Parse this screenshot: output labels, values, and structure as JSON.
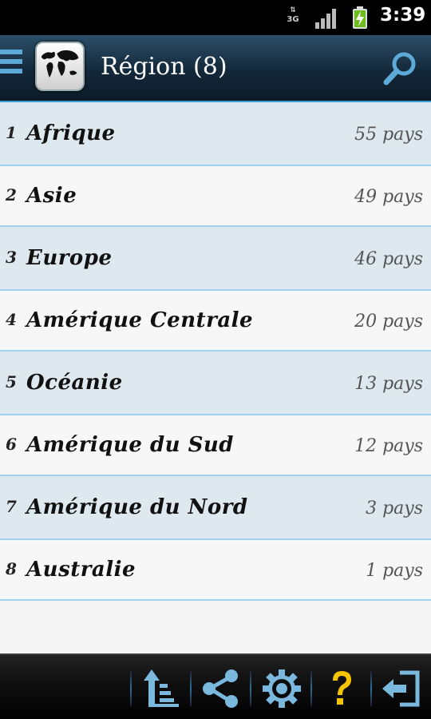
{
  "status_bar": {
    "network": "3G",
    "time": "3:39"
  },
  "action_bar": {
    "title": "Région (8)",
    "icons": [
      "drawer-icon",
      "world-map-icon",
      "search-icon"
    ]
  },
  "regions": [
    {
      "num": "1",
      "name": "Afrique",
      "count": "55 pays"
    },
    {
      "num": "2",
      "name": "Asie",
      "count": "49 pays"
    },
    {
      "num": "3",
      "name": "Europe",
      "count": "46 pays"
    },
    {
      "num": "4",
      "name": "Amérique Centrale",
      "count": "20 pays"
    },
    {
      "num": "5",
      "name": "Océanie",
      "count": "13 pays"
    },
    {
      "num": "6",
      "name": "Amérique du Sud",
      "count": "12 pays"
    },
    {
      "num": "7",
      "name": "Amérique du Nord",
      "count": "3 pays"
    },
    {
      "num": "8",
      "name": "Australie",
      "count": "1 pays"
    }
  ],
  "bottom_bar": {
    "icons": [
      "sort-icon",
      "share-icon",
      "settings-icon",
      "help-icon",
      "exit-icon"
    ]
  },
  "colors": {
    "accent": "#3b9fd6",
    "row_alt": "#dde8ef",
    "help": "#f5c400"
  }
}
